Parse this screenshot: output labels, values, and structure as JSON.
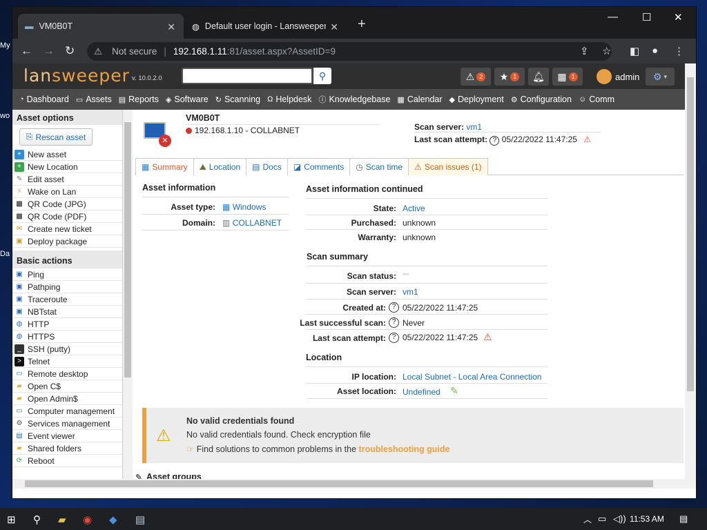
{
  "desktop": {
    "label_1": "My",
    "label_2": "wo",
    "label_3": "Da"
  },
  "browser": {
    "tabs": [
      {
        "title": "VM0B0T"
      },
      {
        "title": "Default user login - Lansweeper"
      }
    ],
    "new_tab": "+",
    "omnibox": {
      "security": "Not secure",
      "host": "192.168.1.11",
      "rest": ":81/asset.aspx?AssetID=9"
    }
  },
  "lansweeper": {
    "logo_part1": "lan",
    "logo_part2": "sweeper",
    "version": "v. 10.0.2.0",
    "search_placeholder": "",
    "header_badges": {
      "alerts": "2",
      "favorites": "1",
      "calendar": "1"
    },
    "user": "admin",
    "menu": [
      "Dashboard",
      "Assets",
      "Reports",
      "Software",
      "Scanning",
      "Helpdesk",
      "Knowledgebase",
      "Calendar",
      "Deployment",
      "Configuration",
      "Comm"
    ]
  },
  "sidebar": {
    "asset_options_title": "Asset options",
    "rescan_label": "Rescan asset",
    "asset_options": [
      "New asset",
      "New Location",
      "Edit asset",
      "Wake on Lan",
      "QR Code (JPG)",
      "QR Code (PDF)",
      "Create new ticket",
      "Deploy package"
    ],
    "basic_actions_title": "Basic actions",
    "basic_actions": [
      "Ping",
      "Pathping",
      "Traceroute",
      "NBTstat",
      "HTTP",
      "HTTPS",
      "SSH (putty)",
      "Telnet",
      "Remote desktop",
      "Open C$",
      "Open Admin$",
      "Computer management",
      "Services management",
      "Event viewer",
      "Shared folders",
      "Reboot"
    ]
  },
  "asset": {
    "name": "VM0B0T",
    "ip_domain": "192.168.1.10 - COLLABNET",
    "scan_server_label": "Scan server:",
    "scan_server": "vm1",
    "last_scan_label": "Last scan attempt:",
    "last_scan": "05/22/2022 11:47:25"
  },
  "content_tabs": [
    "Summary",
    "Location",
    "Docs",
    "Comments",
    "Scan time",
    "Scan issues (1)"
  ],
  "asset_info": {
    "title": "Asset information",
    "type_label": "Asset type:",
    "type_value": "Windows",
    "domain_label": "Domain:",
    "domain_value": "COLLABNET"
  },
  "asset_info_cont": {
    "title": "Asset information continued",
    "state_label": "State:",
    "state": "Active",
    "purchased_label": "Purchased:",
    "purchased": "unknown",
    "warranty_label": "Warranty:",
    "warranty": "unknown"
  },
  "scan_summary": {
    "title": "Scan summary",
    "status_label": "Scan status:",
    "server_label": "Scan server:",
    "server": "vm1",
    "created_label": "Created at:",
    "created": "05/22/2022 11:47:25",
    "success_label": "Last successful scan:",
    "success": "Never",
    "attempt_label": "Last scan attempt:",
    "attempt": "05/22/2022 11:47:25"
  },
  "location": {
    "title": "Location",
    "ip_label": "IP location:",
    "ip": "Local Subnet - Local Area Connection",
    "asset_label": "Asset location:",
    "asset": "Undefined"
  },
  "alert": {
    "title": "No valid credentials found",
    "message": "No valid credentials found. Check encryption file",
    "help_prefix": "Find solutions to common problems in the ",
    "help_link": "troubleshooting guide"
  },
  "asset_groups": "Asset groups",
  "taskbar": {
    "time": "11:53 AM"
  },
  "colors": {
    "brand": "#e9a044",
    "link": "#1a6cb5",
    "danger": "#d7322d",
    "warning": "#e2582b"
  }
}
